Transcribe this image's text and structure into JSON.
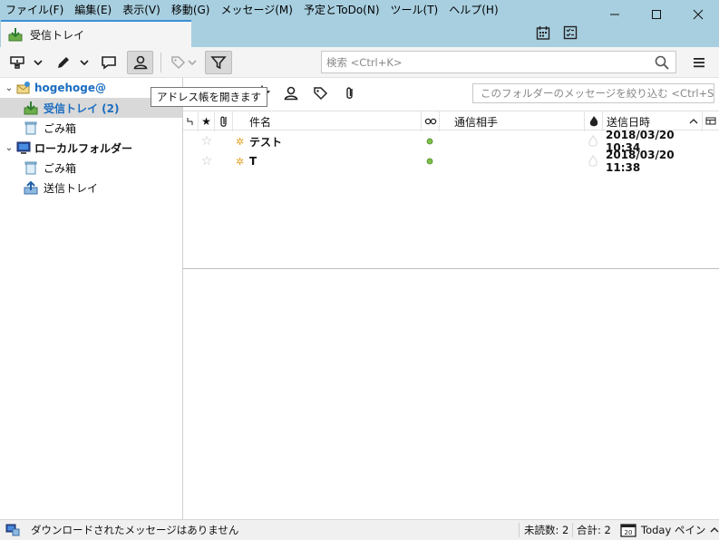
{
  "menubar": {
    "items": [
      "ファイル(F)",
      "編集(E)",
      "表示(V)",
      "移動(G)",
      "メッセージ(M)",
      "予定とToDo(N)",
      "ツール(T)",
      "ヘルプ(H)"
    ]
  },
  "tab": {
    "label": "受信トレイ"
  },
  "search": {
    "placeholder": "検索 <Ctrl+K>"
  },
  "tooltip": "アドレス帳を開きます",
  "quick_filter": {
    "placeholder": "このフォルダーのメッセージを絞り込む <Ctrl+Shift"
  },
  "folders": [
    {
      "label": "hogehoge@",
      "kind": "account"
    },
    {
      "label": "受信トレイ (2)",
      "kind": "inbox"
    },
    {
      "label": "ごみ箱",
      "kind": "trash"
    },
    {
      "label": "ローカルフォルダー",
      "kind": "local"
    },
    {
      "label": "ごみ箱",
      "kind": "trash"
    },
    {
      "label": "送信トレイ",
      "kind": "outbox"
    }
  ],
  "columns": {
    "subject": "件名",
    "correspondent": "通信相手",
    "date": "送信日時"
  },
  "messages": [
    {
      "subject": "テスト",
      "date": "2018/03/20 10:34"
    },
    {
      "subject": "T",
      "date": "2018/03/20 11:38"
    }
  ],
  "statusbar": {
    "message": "ダウンロードされたメッセージはありません",
    "unread": "未読数: 2",
    "total": "合計: 2",
    "today_pane": "Today ペイン"
  },
  "colors": {
    "accent": "#3c8fd6",
    "titlebar": "#a8cfe0",
    "account": "#1a6dc0"
  }
}
